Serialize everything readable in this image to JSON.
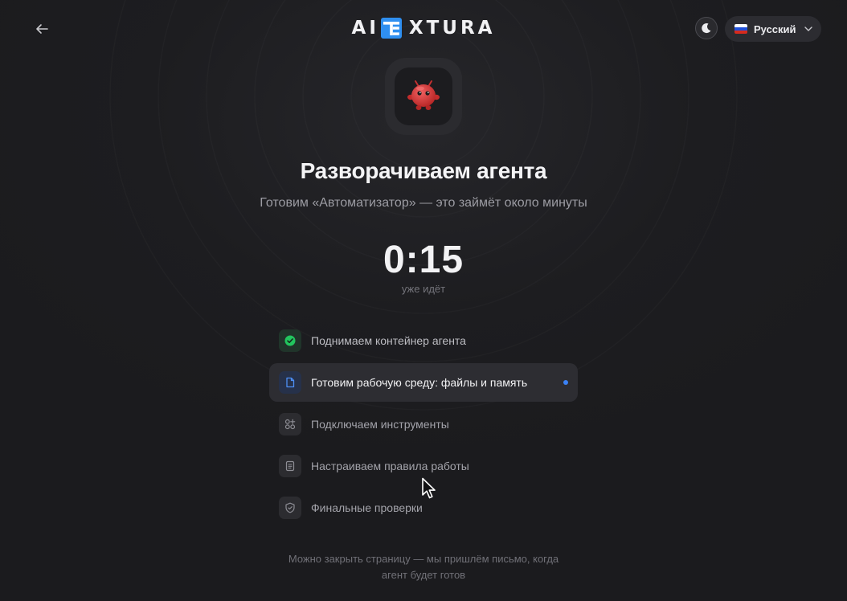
{
  "header": {
    "logo_left": "AI",
    "logo_right": "XTURA",
    "language": {
      "selected": "Русский"
    },
    "icons": {
      "back": "arrow-left-icon",
      "theme": "moon-icon",
      "chevron": "chevron-down-icon"
    }
  },
  "agent": {
    "avatar_icon": "red-robot-mascot"
  },
  "main": {
    "title": "Разворачиваем агента",
    "subtitle": "Готовим «Автоматизатор» — это займёт около минуты",
    "timer": "0:15",
    "timer_caption": "уже идёт"
  },
  "steps": [
    {
      "label": "Поднимаем контейнер агента",
      "status": "done",
      "icon": "check-circle-icon"
    },
    {
      "label": "Готовим рабочую среду: файлы и память",
      "status": "active",
      "icon": "file-icon"
    },
    {
      "label": "Подключаем инструменты",
      "status": "pending",
      "icon": "grid-plus-icon"
    },
    {
      "label": "Настраиваем правила работы",
      "status": "pending",
      "icon": "document-icon"
    },
    {
      "label": "Финальные проверки",
      "status": "pending",
      "icon": "shield-check-icon"
    }
  ],
  "footer": {
    "note_line1": "Можно закрыть страницу — мы пришлём письмо, когда",
    "note_line2": "агент будет готов"
  },
  "colors": {
    "background": "#1c1c1f",
    "accent_blue": "#3b82f6",
    "success_green": "#22c55e",
    "mascot_red": "#d63a3a"
  }
}
